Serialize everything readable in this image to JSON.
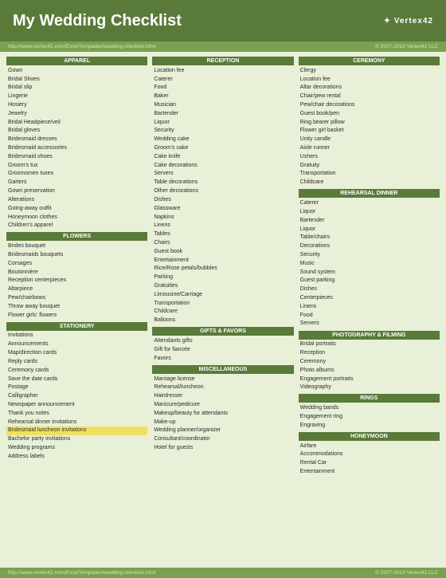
{
  "header": {
    "title": "My Wedding Checklist",
    "logo_line1": "✦ Vertex42",
    "logo_line2": ""
  },
  "url_top": "http://www.vertex42.com/ExcelTemplates/wedding-checklist.html",
  "copyright_top": "© 2007-2013 Vertex42 LLC",
  "columns": {
    "col1": {
      "sections": [
        {
          "header": "APPAREL",
          "items": [
            "Gown",
            "Bridal Shoes",
            "Bridal slip",
            "Lingerie",
            "Hosiery",
            "Jewelry",
            "Bridal Headpiece/veil",
            "Bridal gloves",
            "Bridesmaid dresses",
            "Bridesmaid accessories",
            "Bridesmaid shoes",
            "Groom's tux",
            "Groomsmen tuxes",
            "Garters",
            "Gown preservation",
            "Alterations",
            "Going-away outfit",
            "Honeymoon clothes",
            "Children's apparel"
          ]
        },
        {
          "header": "FLOWERS",
          "items": [
            "Brides bouquet",
            "Bridesmaids bouquets",
            "Corsages",
            "Boutonnière",
            "Reception centerpieces",
            "Altarpiece",
            "Pew/chairbows",
            "Throw away bouquet",
            "Flower girls' flowers"
          ]
        },
        {
          "header": "STATIONERY",
          "items": [
            "Invitations",
            "Announcements",
            "Map/direction cards",
            "Reply cards",
            "Ceremony cards",
            "Save the date cards",
            "Postage",
            "Calligrapher",
            "Newspaper announcement",
            "Thank you notes",
            "Rehearsal dinner invitations",
            "Bridesmaid luncheon invitations",
            "Bachelor party invitations",
            "Wedding programs",
            "Address labels"
          ]
        }
      ]
    },
    "col2": {
      "sections": [
        {
          "header": "RECEPTION",
          "items": [
            "Location fee",
            "Caterer",
            "Food",
            "Baker",
            "Musician",
            "Bartender",
            "Liquor",
            "Security",
            "Wedding cake",
            "Groom's cake",
            "Cake knife",
            "Cake decorations",
            "Servers",
            "Table decorations",
            "Other decorations",
            "Dishes",
            "Glassware",
            "Napkins",
            "Linens",
            "Tables",
            "Chairs",
            "Guest book",
            "Entertainment",
            "Rice/Rose petals/bubbles",
            "Parking",
            "Gratuities",
            "Limousine/Carriage",
            "Transportation",
            "Childcare",
            "Balloons"
          ]
        },
        {
          "header": "GIFTS & FAVORS",
          "items": [
            "Attendants gifts",
            "Gift for fiancée",
            "Favors"
          ]
        },
        {
          "header": "MISCELLANEOUS",
          "items": [
            "Marriage license",
            "Rehearsal/luncheon",
            "Hairdresser",
            "Manicure/pedicure",
            "Makeup/beauty for attendants",
            "Make-up",
            "Wedding planner/organizer",
            "Consultant/coordinator",
            "Hotel for guests"
          ]
        }
      ]
    },
    "col3": {
      "sections": [
        {
          "header": "CEREMONY",
          "items": [
            "Clergy",
            "Location fee",
            "Altar decorations",
            "Chair/pew rental",
            "Pew/chair decorations",
            "Guest book/pen",
            "Ring bearer pillow",
            "Flower girl basket",
            "Unity candle",
            "Aisle runner",
            "Ushers",
            "Gratuity",
            "Transportation",
            "Childcare"
          ]
        },
        {
          "header": "REHEARSAL DINNER",
          "items": [
            "Caterer",
            "Liquor",
            "Bartender",
            "Liquor",
            "Table/chairs",
            "Decorations",
            "Security",
            "Music",
            "Sound system",
            "Guest parking",
            "Dishes",
            "Centerpieces",
            "Linens",
            "Food",
            "Servers"
          ]
        },
        {
          "header": "PHOTOGRAPHY & FILMING",
          "items": [
            "Bridal portraits",
            "Reception",
            "Ceremony",
            "Photo albums",
            "Engagement portraits",
            "Videography"
          ]
        },
        {
          "header": "RINGS",
          "items": [
            "Wedding bands",
            "Engagement ring",
            "Engraving"
          ]
        },
        {
          "header": "HONEYMOON",
          "items": [
            "Airfare",
            "Accommodations",
            "Rental Car",
            "Entertainment"
          ]
        }
      ]
    }
  },
  "url_bottom": "http://www.vertex42.com/ExcelTemplates/wedding-checklist.html",
  "copyright_bottom": "© 2007-2013 Vertex42 LLC"
}
